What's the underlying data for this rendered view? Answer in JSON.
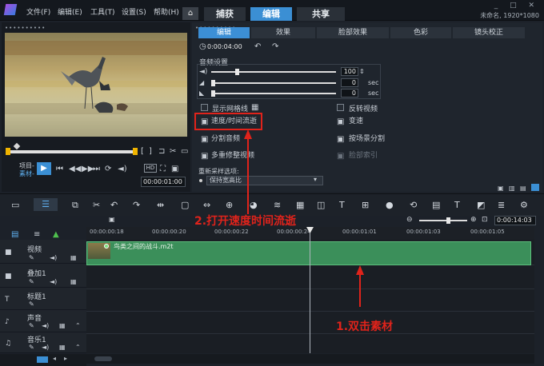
{
  "menu": {
    "file": "文件(F)",
    "edit": "编辑(E)",
    "tools": "工具(T)",
    "settings": "设置(S)",
    "help": "帮助(H)"
  },
  "main_tabs": {
    "home": "⌂",
    "capture": "捕获",
    "edit": "编辑",
    "share": "共享"
  },
  "window_controls": "_ □ ✕",
  "project_info": "未命名, 1920*1080",
  "preview": {
    "project_label": "项目-",
    "clip_label": "素材-",
    "timecode": "00:00:01:00",
    "size_label": "HD"
  },
  "options_tabs": [
    "编辑",
    "效果",
    "脸部效果",
    "色彩",
    "镜头校正"
  ],
  "options": {
    "timecode": "0:00:04:00",
    "audio_settings": "音频设置",
    "volume_value": "100",
    "fadein_value": "0",
    "fadeout_value": "0",
    "sec": "sec",
    "show_grid": "显示网格线",
    "reverse_video": "反转视频",
    "speed_time_lapse": "速度/时间流逝",
    "speed_change": "变速",
    "split_audio": "分割音频",
    "split_by_scene": "按场景分割",
    "multi_trim": "多重修整视频",
    "face_index": "脸部索引",
    "resample": "重新采样选项:",
    "resample_value": "保持宽高比"
  },
  "timeline": {
    "timecode": "0:00:14:03",
    "ticks": [
      "00:00:00:18",
      "00:00:00:20",
      "00:00:00:22",
      "00:00:00:24",
      "00:00:01:01",
      "00:00:01:03",
      "00:00:01:05"
    ],
    "clip_name": "鸟类之间的战斗.m2t",
    "tracks": [
      "视频",
      "叠加1",
      "标题1",
      "声音",
      "音乐1"
    ]
  },
  "annotations": {
    "step1": "1.双击素材",
    "step2": "2.打开速度时间流逝"
  },
  "colors": {
    "accent": "#3b8fd4",
    "annotation": "#e0231b",
    "clip": "#3b8f5a"
  }
}
